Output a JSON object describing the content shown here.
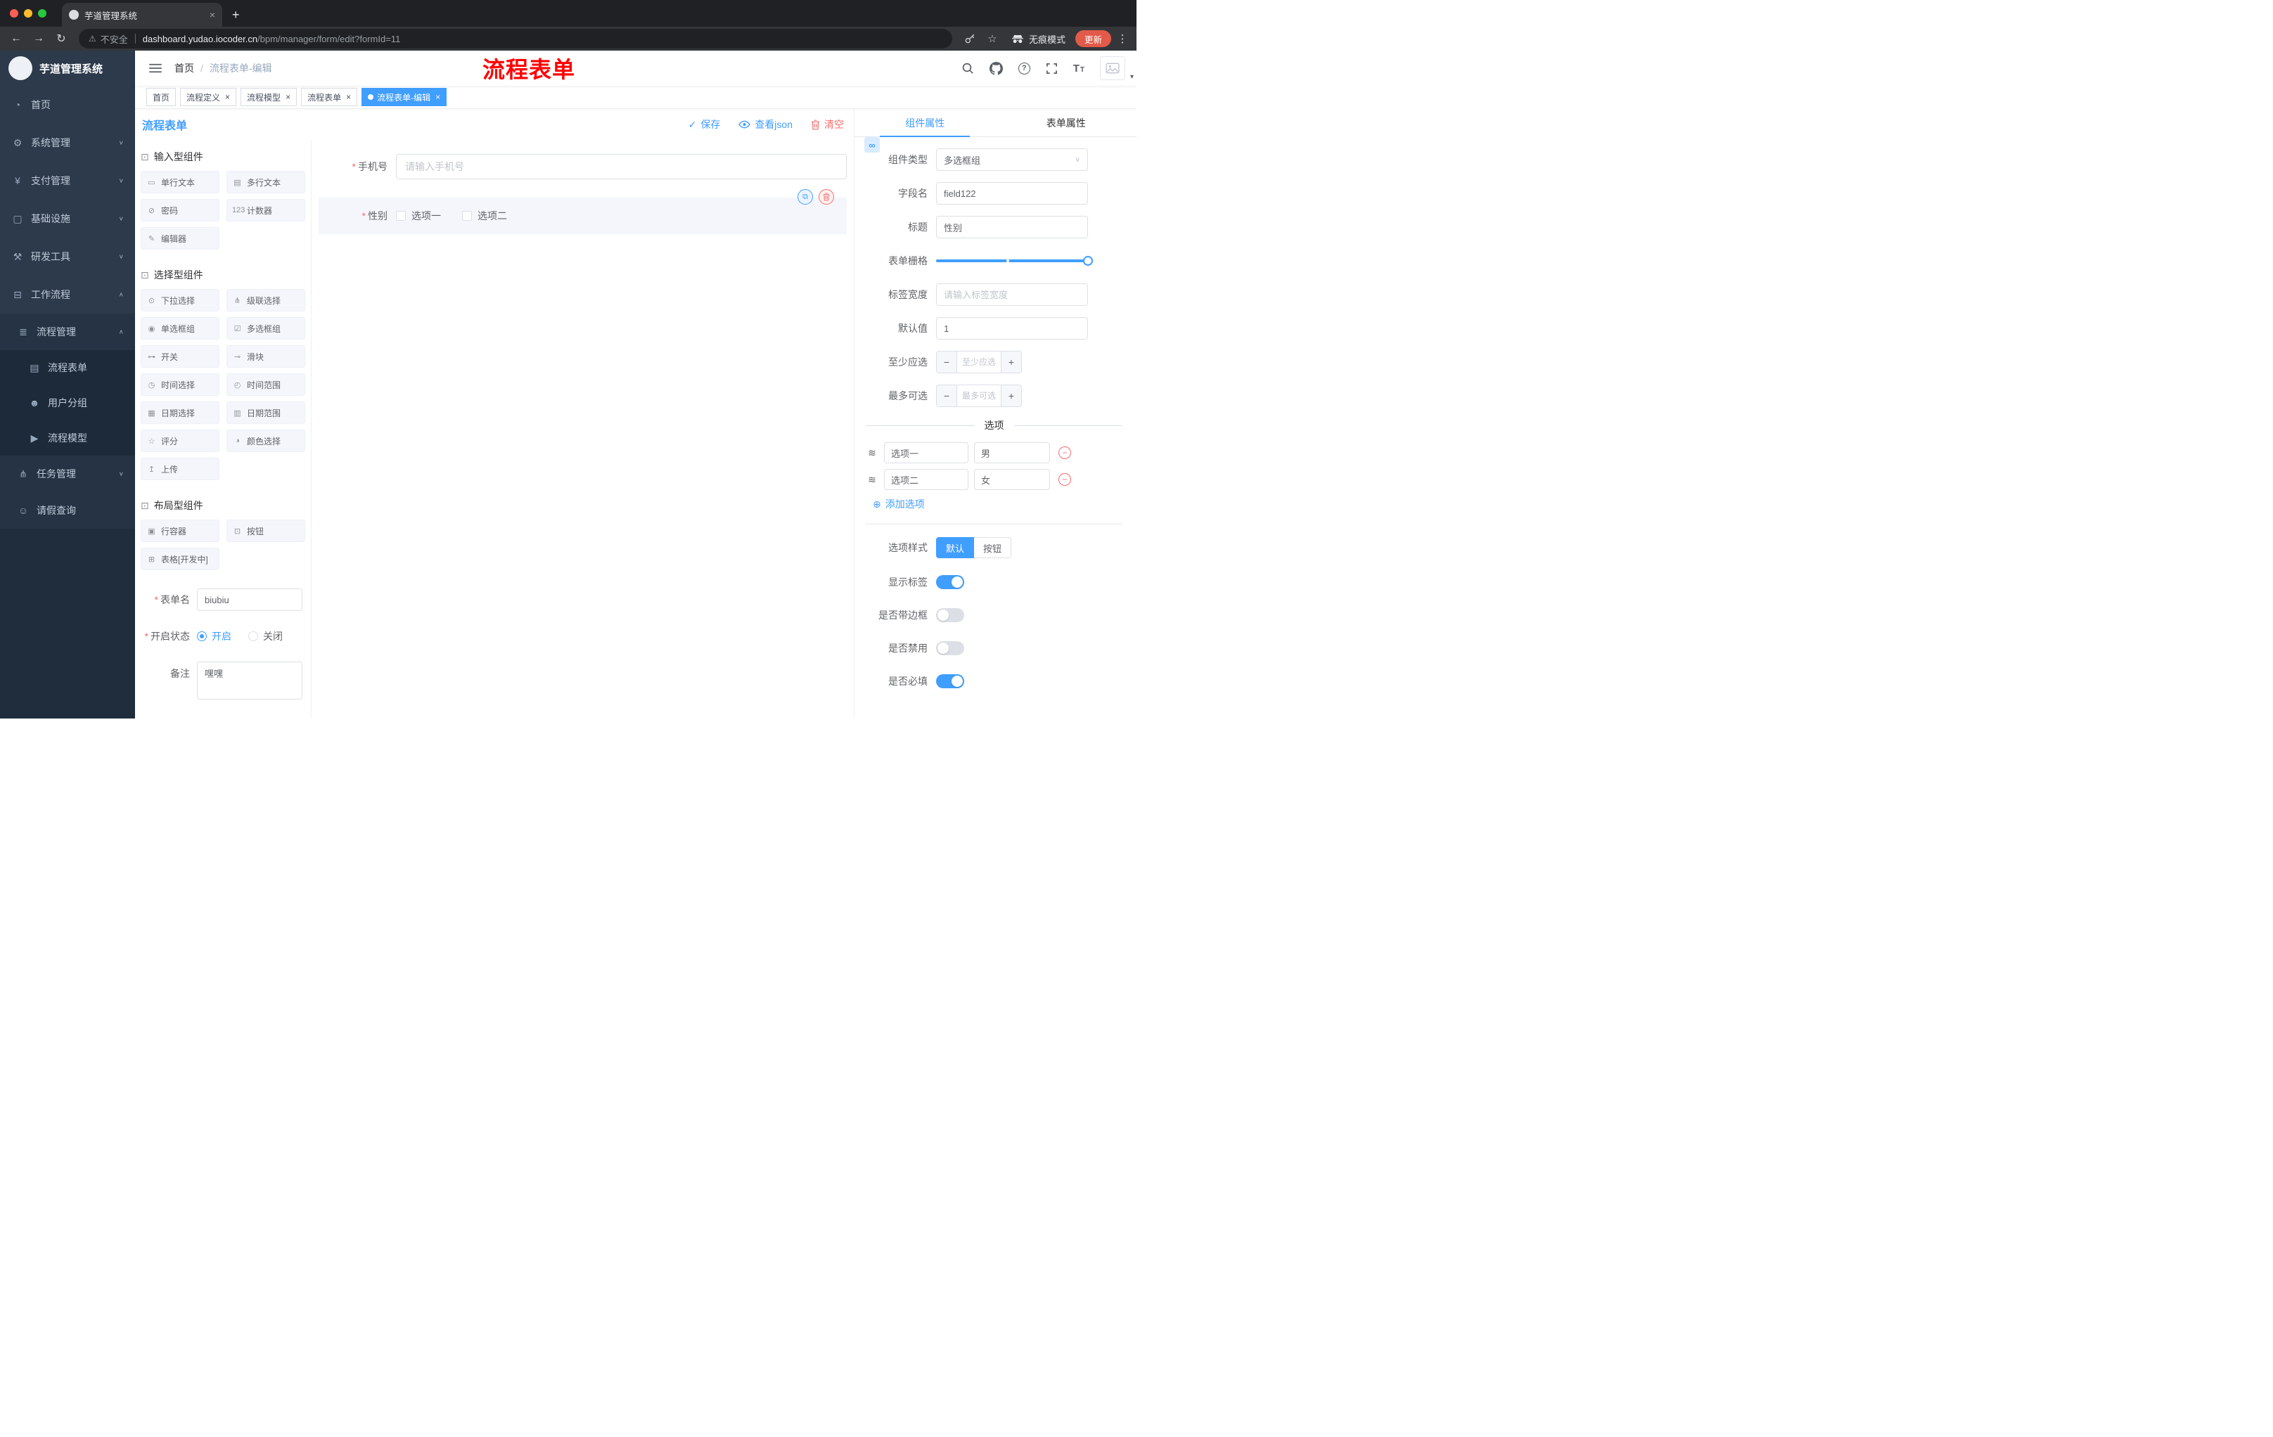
{
  "ui": {
    "close_glyph": "×",
    "check_glyph": "✓",
    "caret_down": "∨",
    "add_glyph": "⊕",
    "minus_glyph": "−",
    "plus_glyph": "+",
    "drag_glyph": "≋",
    "copy_glyph": "⧉",
    "link_glyph": "∞"
  },
  "browser": {
    "tab_title": "芋道管理系统",
    "new_tab_glyph": "+",
    "back_glyph": "←",
    "forward_glyph": "→",
    "reload_glyph": "↻",
    "warning_glyph": "⚠",
    "security_label": "不安全",
    "url_domain": "dashboard.yudao.iocoder.cn",
    "url_path": "/bpm/manager/form/edit?formId=11",
    "star_glyph": "☆",
    "incognito_label": "无痕模式",
    "update_label": "更新",
    "menu_glyph": "⋮"
  },
  "header": {
    "breadcrumb_home": "首页",
    "breadcrumb_sep": "/",
    "breadcrumb_current": "流程表单-编辑",
    "annotation": "流程表单",
    "help_glyph": "?",
    "font_large": "T",
    "font_small": "T",
    "avatar_caret": "▾"
  },
  "sidebar": {
    "logo_title": "芋道管理系统",
    "items": [
      {
        "icon": "◔",
        "label": "首页",
        "chevron": ""
      },
      {
        "icon": "⚙",
        "label": "系统管理",
        "chevron": "∨"
      },
      {
        "icon": "¥",
        "label": "支付管理",
        "chevron": "∨"
      },
      {
        "icon": "▢",
        "label": "基础设施",
        "chevron": "∨"
      },
      {
        "icon": "⚒",
        "label": "研发工具",
        "chevron": "∨"
      },
      {
        "icon": "⊟",
        "label": "工作流程",
        "chevron": "∧"
      }
    ],
    "workflow_children": [
      {
        "icon": "≣",
        "label": "流程管理",
        "chevron": "∧"
      },
      {
        "icon": "⋔",
        "label": "任务管理",
        "chevron": "∨"
      },
      {
        "icon": "☺",
        "label": "请假查询",
        "chevron": ""
      }
    ],
    "process_children": [
      {
        "icon": "▤",
        "label": "流程表单"
      },
      {
        "icon": "☻",
        "label": "用户分组"
      },
      {
        "icon": "▶",
        "label": "流程模型"
      }
    ]
  },
  "tags": [
    {
      "label": "首页",
      "active": false,
      "closable": false
    },
    {
      "label": "流程定义",
      "active": false,
      "closable": true
    },
    {
      "label": "流程模型",
      "active": false,
      "closable": true
    },
    {
      "label": "流程表单",
      "active": false,
      "closable": true
    },
    {
      "label": "流程表单-编辑",
      "active": true,
      "closable": true
    }
  ],
  "designer": {
    "title": "流程表单",
    "save_label": "保存",
    "view_json_label": "查看json",
    "clear_label": "清空"
  },
  "palette": {
    "sections": [
      {
        "icon": "⊡",
        "title": "输入型组件",
        "items": [
          {
            "icon": "▭",
            "label": "单行文本"
          },
          {
            "icon": "▤",
            "label": "多行文本"
          },
          {
            "icon": "⊘",
            "label": "密码"
          },
          {
            "icon": "123",
            "label": "计数器"
          },
          {
            "icon": "✎",
            "label": "编辑器"
          }
        ]
      },
      {
        "icon": "⊡",
        "title": "选择型组件",
        "items": [
          {
            "icon": "⊙",
            "label": "下拉选择"
          },
          {
            "icon": "⋔",
            "label": "级联选择"
          },
          {
            "icon": "◉",
            "label": "单选框组"
          },
          {
            "icon": "☑",
            "label": "多选框组"
          },
          {
            "icon": "⊶",
            "label": "开关"
          },
          {
            "icon": "⊸",
            "label": "滑块"
          },
          {
            "icon": "◷",
            "label": "时间选择"
          },
          {
            "icon": "◴",
            "label": "时间范围"
          },
          {
            "icon": "▦",
            "label": "日期选择"
          },
          {
            "icon": "▥",
            "label": "日期范围"
          },
          {
            "icon": "☆",
            "label": "评分"
          },
          {
            "icon": "◑",
            "label": "颜色选择"
          },
          {
            "icon": "↥",
            "label": "上传"
          }
        ]
      },
      {
        "icon": "⊡",
        "title": "布局型组件",
        "items": [
          {
            "icon": "▣",
            "label": "行容器"
          },
          {
            "icon": "⊡",
            "label": "按钮"
          },
          {
            "icon": "⊞",
            "label": "表格[开发中]"
          }
        ]
      }
    ]
  },
  "meta": {
    "required_mark": "*",
    "form_name_label": "表单名",
    "form_name_value": "biubiu",
    "status_label": "开启状态",
    "status_on": "开启",
    "status_off": "关闭",
    "remark_label": "备注",
    "remark_value": "嘿嘿"
  },
  "canvas": {
    "phone_label": "手机号",
    "phone_placeholder": "请输入手机号",
    "gender_label": "性别",
    "gender_options": [
      "选项一",
      "选项二"
    ]
  },
  "props": {
    "tab_component": "组件属性",
    "tab_form": "表单属性",
    "component_type_label": "组件类型",
    "component_type_value": "多选框组",
    "field_name_label": "字段名",
    "field_name_value": "field122",
    "title_label": "标题",
    "title_value": "性别",
    "grid_label": "表单栅格",
    "label_width_label": "标签宽度",
    "label_width_placeholder": "请输入标签宽度",
    "default_label": "默认值",
    "default_value": "1",
    "min_label": "至少应选",
    "min_placeholder": "至少应选",
    "max_label": "最多可选",
    "max_placeholder": "最多可选",
    "options_title": "选项",
    "options": [
      {
        "label": "选项一",
        "value": "男"
      },
      {
        "label": "选项二",
        "value": "女"
      }
    ],
    "add_option_label": "添加选项",
    "style_label": "选项样式",
    "style_default": "默认",
    "style_button": "按钮",
    "switches": [
      {
        "label": "显示标签",
        "on": true
      },
      {
        "label": "是否带边框",
        "on": false
      },
      {
        "label": "是否禁用",
        "on": false
      },
      {
        "label": "是否必填",
        "on": true
      }
    ]
  }
}
